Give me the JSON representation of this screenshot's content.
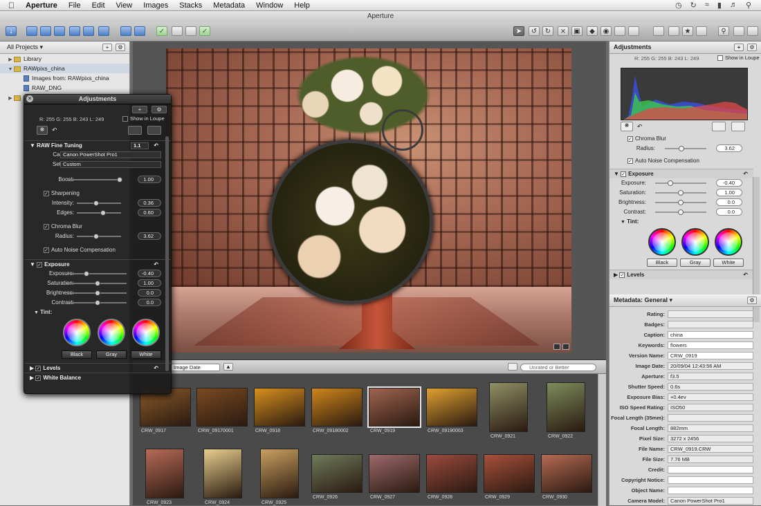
{
  "menubar": {
    "app": "Aperture",
    "items": [
      "File",
      "Edit",
      "View",
      "Images",
      "Stacks",
      "Metadata",
      "Window",
      "Help"
    ]
  },
  "window_title": "Aperture",
  "projects": {
    "header": "All Projects",
    "items": [
      {
        "label": "Library"
      },
      {
        "label": "RAWpixs_china"
      },
      {
        "label": "Images from: RAWpixs_china"
      },
      {
        "label": "RAW_DNG"
      }
    ]
  },
  "hud": {
    "title": "Adjustments",
    "readout": "R: 255   G: 255   B: 243   L: 249",
    "show_in_loupe": "Show in Loupe",
    "raw_section": "RAW Fine Tuning",
    "raw_version": "1.1",
    "camera_label": "Camera:",
    "camera_value": "Canon PowerShot Pro1",
    "settings_label": "Settings:",
    "settings_value": "Custom",
    "boost_label": "Boost:",
    "boost_value": "1.00",
    "sharpening": "Sharpening",
    "intensity_label": "Intensity:",
    "intensity_value": "0.36",
    "edges_label": "Edges:",
    "edges_value": "0.60",
    "chroma_blur": "Chroma Blur",
    "radius_label": "Radius:",
    "radius_value": "3.62",
    "auto_noise": "Auto Noise Compensation",
    "exposure_section": "Exposure",
    "exposure_label": "Exposure:",
    "exposure_value": "-0.40",
    "saturation_label": "Saturation:",
    "saturation_value": "1.00",
    "brightness_label": "Brightness:",
    "brightness_value": "0.0",
    "contrast_label": "Contrast:",
    "contrast_value": "0.0",
    "tint_label": "Tint:",
    "black": "Black",
    "gray": "Gray",
    "white": "White",
    "levels": "Levels",
    "white_balance": "White Balance"
  },
  "browser": {
    "sort": "Image Date",
    "search_placeholder": "Unrated or Better",
    "thumbs": [
      {
        "name": "CRW_0917",
        "color": "#8a5a2a"
      },
      {
        "name": "CRW_09170001",
        "color": "#7a4a22"
      },
      {
        "name": "CRW_0918",
        "color": "#d8901e"
      },
      {
        "name": "CRW_09180002",
        "color": "#d0861c"
      },
      {
        "name": "CRW_0919",
        "color": "#a06450"
      },
      {
        "name": "CRW_09190003",
        "color": "#e0a030"
      },
      {
        "name": "CRW_0921",
        "color": "#8f9066"
      },
      {
        "name": "CRW_0922",
        "color": "#7d8c5c"
      },
      {
        "name": "CRW_0923",
        "color": "#b86a58"
      },
      {
        "name": "CRW_0924",
        "color": "#e8cf8e"
      },
      {
        "name": "CRW_0925",
        "color": "#c9a060"
      },
      {
        "name": "CRW_0926",
        "color": "#6f7b5a"
      },
      {
        "name": "CRW_0927",
        "color": "#9d6a6a"
      },
      {
        "name": "CRW_0928",
        "color": "#9c4a3e"
      },
      {
        "name": "CRW_0929",
        "color": "#a8503c"
      },
      {
        "name": "CRW_0930",
        "color": "#b66a54"
      }
    ]
  },
  "adjust": {
    "title": "Adjustments",
    "readout": "R: 255   G: 255   B: 243   L: 249",
    "show_in_loupe": "Show in Loupe",
    "chroma_blur": "Chroma Blur",
    "radius_label": "Radius:",
    "radius_value": "3.62",
    "auto_noise": "Auto Noise Compensation",
    "exposure_section": "Exposure",
    "exposure_label": "Exposure:",
    "exposure_value": "-0.40",
    "saturation_label": "Saturation:",
    "saturation_value": "1.00",
    "brightness_label": "Brightness:",
    "brightness_value": "0.0",
    "contrast_label": "Contrast:",
    "contrast_value": "0.0",
    "tint_label": "Tint:",
    "black": "Black",
    "gray": "Gray",
    "white": "White",
    "levels": "Levels"
  },
  "metadata": {
    "title": "Metadata: General",
    "rows": [
      {
        "k": "Rating:",
        "v": ""
      },
      {
        "k": "Badges:",
        "v": ""
      },
      {
        "k": "Caption:",
        "v": "china"
      },
      {
        "k": "Keywords:",
        "v": "flowers"
      },
      {
        "k": "Version Name:",
        "v": "CRW_0919"
      },
      {
        "k": "Image Date:",
        "v": "20/09/04 12:43:56 AM"
      },
      {
        "k": "Aperture:",
        "v": "f3.5"
      },
      {
        "k": "Shutter Speed:",
        "v": "0.6s"
      },
      {
        "k": "Exposure Bias:",
        "v": "+0.4ev"
      },
      {
        "k": "ISO Speed Rating:",
        "v": "ISO50"
      },
      {
        "k": "Focal Length (35mm):",
        "v": ""
      },
      {
        "k": "Focal Length:",
        "v": "882mm"
      },
      {
        "k": "Pixel Size:",
        "v": "3272 x 2456"
      },
      {
        "k": "File Name:",
        "v": "CRW_0919.CRW"
      },
      {
        "k": "File Size:",
        "v": "7.76 MB"
      },
      {
        "k": "Credit:",
        "v": ""
      },
      {
        "k": "Copyright Notice:",
        "v": ""
      },
      {
        "k": "Object Name:",
        "v": ""
      },
      {
        "k": "Camera Model:",
        "v": "Canon PowerShot Pro1"
      }
    ]
  }
}
